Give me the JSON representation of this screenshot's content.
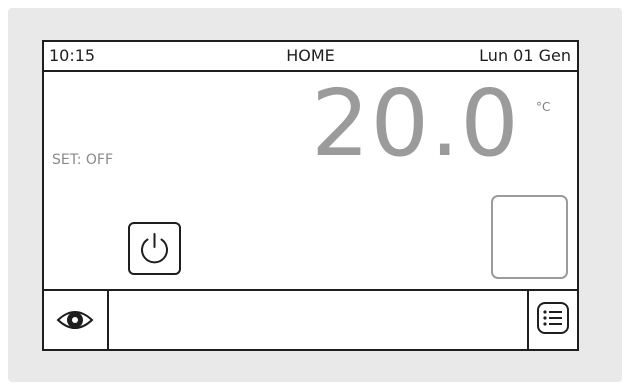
{
  "status_bar": {
    "time": "10:15",
    "title": "HOME",
    "date": "Lun 01 Gen"
  },
  "main": {
    "temperature": "20.0",
    "unit": "°C",
    "setpoint_label": "SET: OFF"
  },
  "icons": {
    "power": "power-icon",
    "eye": "eye-icon",
    "menu": "menu-list-icon"
  },
  "colors": {
    "frame": "#1e1e1e",
    "temperature_text": "#9b9b9b",
    "bezel": "#e9e9ea"
  }
}
